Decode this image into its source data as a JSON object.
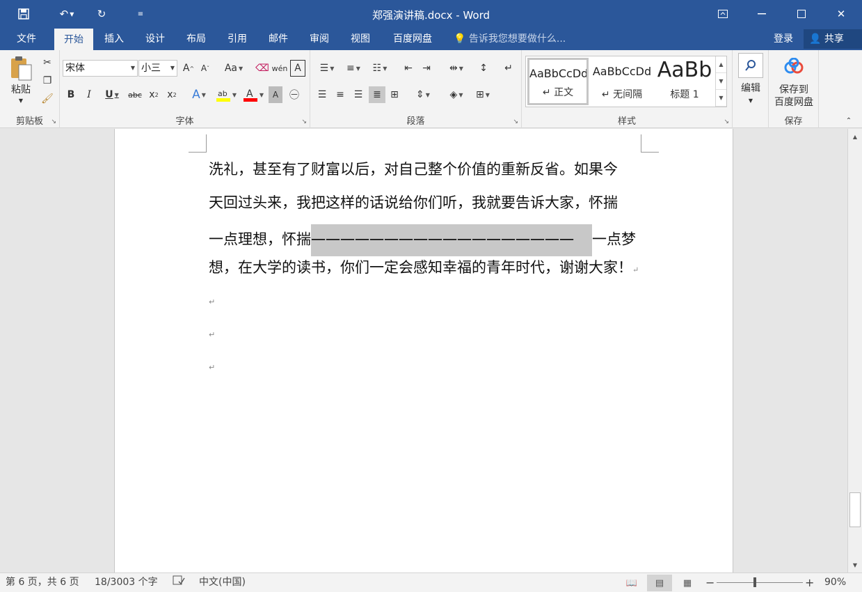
{
  "window": {
    "title": "郑强演讲稿.docx - Word"
  },
  "tabs": [
    {
      "label": "文件"
    },
    {
      "label": "开始"
    },
    {
      "label": "插入"
    },
    {
      "label": "设计"
    },
    {
      "label": "布局"
    },
    {
      "label": "引用"
    },
    {
      "label": "邮件"
    },
    {
      "label": "审阅"
    },
    {
      "label": "视图"
    },
    {
      "label": "百度网盘"
    }
  ],
  "tell_me": "告诉我您想要做什么...",
  "account": {
    "login": "登录",
    "share": "共享"
  },
  "ribbon": {
    "clipboard": {
      "label": "剪贴板",
      "paste": "粘贴"
    },
    "font": {
      "label": "字体",
      "font_name": "宋体",
      "font_size": "小三"
    },
    "paragraph": {
      "label": "段落"
    },
    "styles": {
      "label": "样式",
      "items": [
        {
          "preview": "AaBbCcDd",
          "name": "↵ 正文"
        },
        {
          "preview": "AaBbCcDd",
          "name": "↵ 无间隔"
        },
        {
          "preview": "AaBb",
          "name": "标题 1"
        }
      ]
    },
    "editing": {
      "label": "编辑"
    },
    "save": {
      "button": "保存到\n百度网盘",
      "label": "保存"
    }
  },
  "document": {
    "lines": [
      "洗礼，甚至有了财富以后，对自己整个价值的重新反省。如果今",
      "天回过头来，我把这样的话说给你们听，我就要告诉大家，怀揣",
      "想，在大学的读书，你们一定会感知幸福的青年时代，谢谢大家！"
    ],
    "line3_before": "一点理想，怀揣",
    "line3_highlight": "一一一一一一一一一一一一一一一一一一",
    "line3_after": "一点梦",
    "para_mark": "↵"
  },
  "status": {
    "page": "第 6 页，共 6 页",
    "words": "18/3003 个字",
    "language": "中文(中国)",
    "zoom": "90%",
    "zoom_percent": 90
  },
  "colors": {
    "brand": "#2b579a",
    "highlight_bar": "#ffff00",
    "font_color_bar": "#ff0000"
  }
}
